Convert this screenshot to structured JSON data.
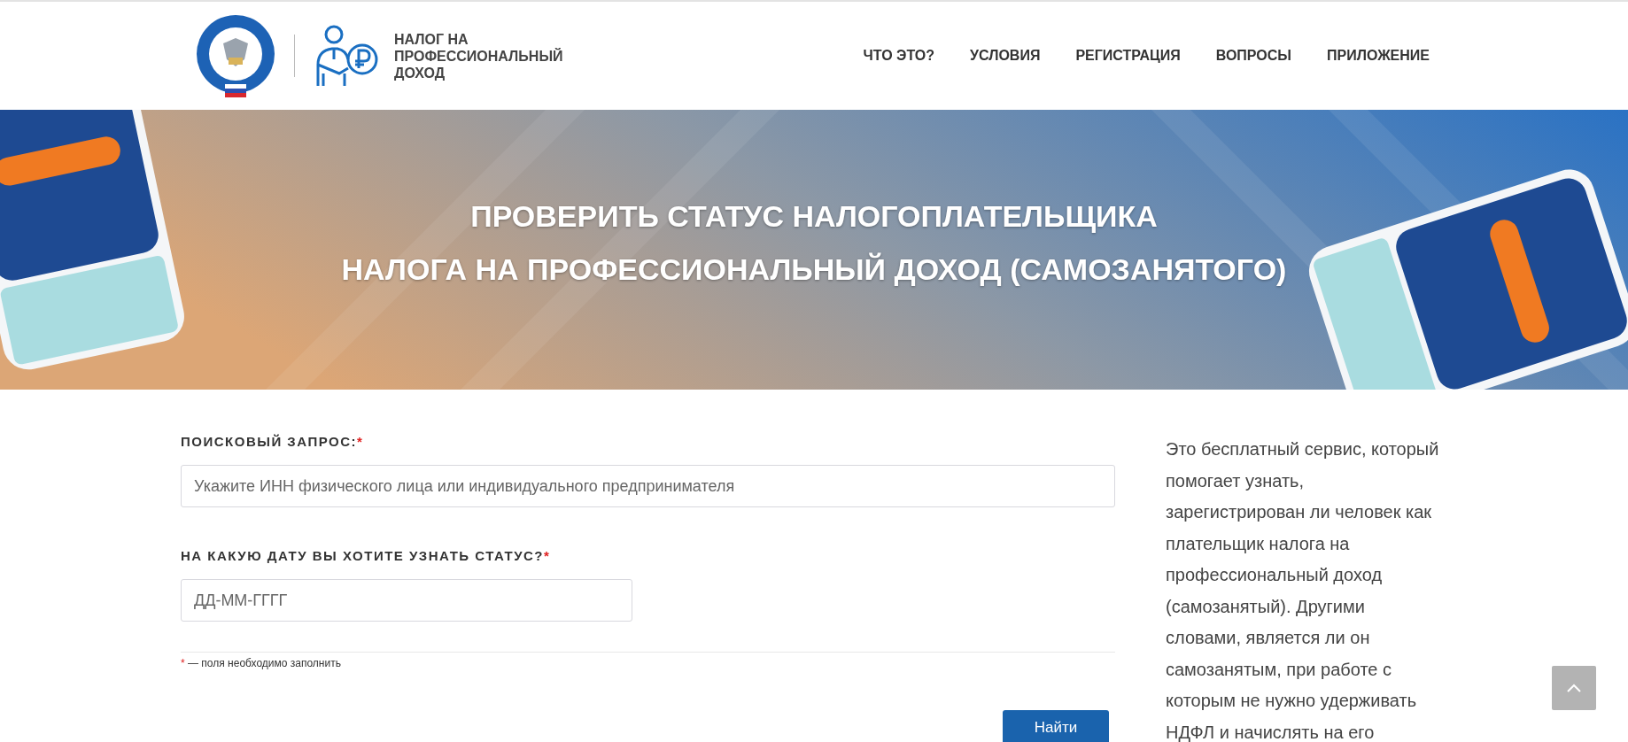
{
  "header": {
    "logo_text": [
      "НАЛОГ НА",
      "ПРОФЕССИОНАЛЬНЫЙ",
      "ДОХОД"
    ],
    "nav": [
      {
        "label": "ЧТО ЭТО?"
      },
      {
        "label": "УСЛОВИЯ"
      },
      {
        "label": "РЕГИСТРАЦИЯ"
      },
      {
        "label": "ВОПРОСЫ"
      },
      {
        "label": "ПРИЛОЖЕНИЕ"
      }
    ]
  },
  "banner": {
    "title": [
      "ПРОВЕРИТЬ СТАТУС НАЛОГОПЛАТЕЛЬЩИКА",
      "НАЛОГА НА ПРОФЕССИОНАЛЬНЫЙ ДОХОД (САМОЗАНЯТОГО)"
    ]
  },
  "form": {
    "fields": [
      {
        "label": "ПОИСКОВЫЙ ЗАПРОС:",
        "required_mark": "*",
        "placeholder": "Укажите ИНН физического лица или индивидуального предпринимателя",
        "kind": "wide"
      },
      {
        "label": "НА КАКУЮ ДАТУ ВЫ ХОТИТЕ УЗНАТЬ СТАТУС?",
        "required_mark": "*",
        "placeholder": "ДД-ММ-ГГГГ",
        "kind": "short"
      }
    ],
    "note_mark": "*",
    "note": "— поля необходимо заполнить",
    "submit": "Найти"
  },
  "sidebar": {
    "text": "Это бесплатный сервис, который помогает узнать, зарегистрирован ли человек как плательщик налога на профессиональный доход (самозанятый). Другими словами, является ли он самозанятым, при работе с которым не нужно удерживать НДФЛ и начислять на его"
  }
}
